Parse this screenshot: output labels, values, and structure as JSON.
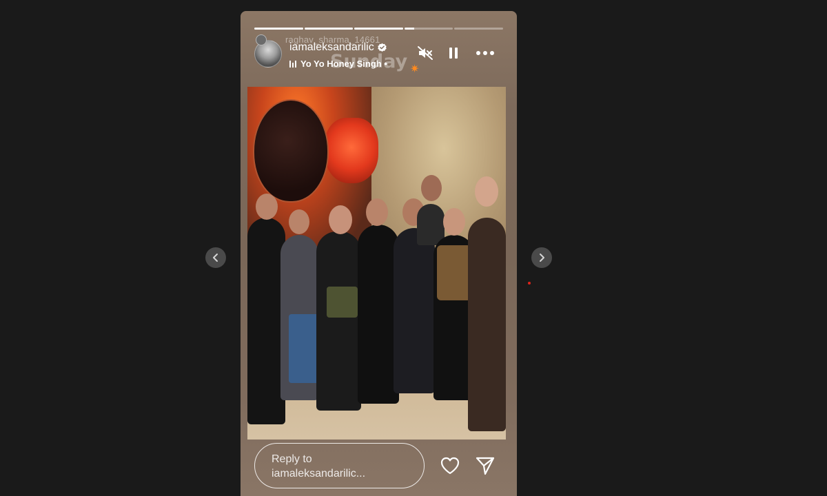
{
  "story": {
    "progress": [
      1,
      1,
      1,
      0.2,
      0
    ],
    "header": {
      "previous_username": "raghav_sharma_14661",
      "username": "iamaleksandarilic",
      "verified": true,
      "music": "Yo Yo Honey Singh •",
      "sticker_text": "Sunday",
      "icons": [
        "speaker-muted-icon",
        "pause-icon",
        "more-icon"
      ]
    },
    "reply": {
      "placeholder_line1": "Reply to",
      "placeholder_line2": "iamaleksandarilic..."
    },
    "actions": [
      "heart-icon",
      "send-icon"
    ]
  },
  "nav": {
    "prev_icon": "chevron-left-icon",
    "next_icon": "chevron-right-icon"
  },
  "colors": {
    "page_bg": "#1a1a1a",
    "story_bg": "#7d6a5b",
    "text": "#ffffff",
    "verified_badge": "#ffffff",
    "nav_button": "#4a4a4a",
    "indicator_dot": "#e0241b"
  }
}
